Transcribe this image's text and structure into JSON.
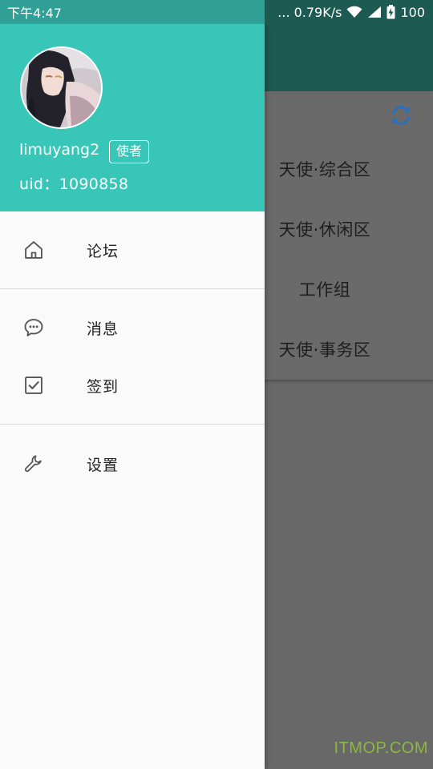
{
  "status_bar": {
    "time": "下午4:47",
    "net_speed": "... 0.79K/s",
    "battery": "100"
  },
  "drawer": {
    "user": {
      "name": "limuyang2",
      "role": "使者",
      "uid": "uid：1090858"
    },
    "menu": [
      {
        "label": "论坛",
        "icon": "home-icon"
      },
      {
        "label": "消息",
        "icon": "chat-bubble-icon"
      },
      {
        "label": "签到",
        "icon": "checkbox-icon"
      },
      {
        "label": "设置",
        "icon": "wrench-icon"
      }
    ]
  },
  "background": {
    "forums": [
      "天使·综合区",
      "天使·休闲区",
      "工作组",
      "天使·事务区"
    ],
    "refresh_icon": "refresh-icon"
  },
  "watermark": "ITMOP.COM",
  "colors": {
    "header": "#38c6b8",
    "appbar_dimmed": "#1d5a52",
    "refresh_accent": "#2d6fb9"
  }
}
